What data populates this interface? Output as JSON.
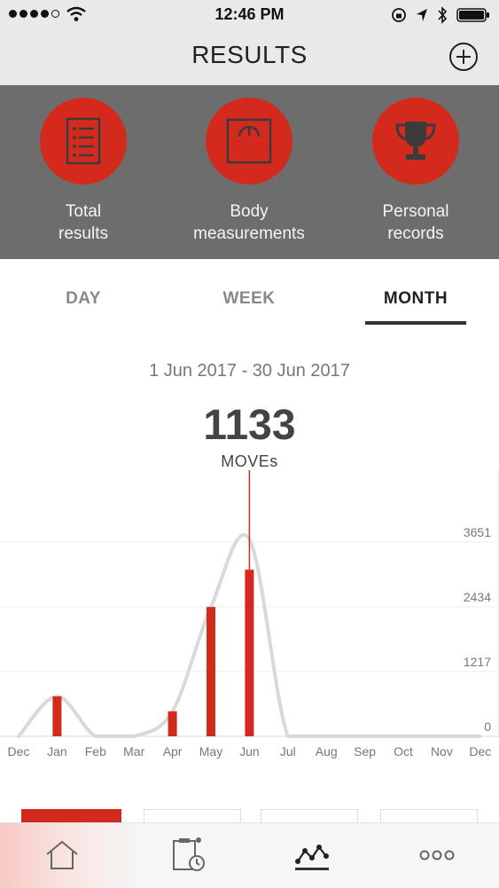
{
  "status_bar": {
    "time": "12:46 PM"
  },
  "header": {
    "title": "RESULTS",
    "add_icon": "plus-circle-icon"
  },
  "categories": [
    {
      "label": "Total\nresults",
      "icon": "list-icon"
    },
    {
      "label": "Body\nmeasurements",
      "icon": "scale-icon"
    },
    {
      "label": "Personal\nrecords",
      "icon": "trophy-icon"
    }
  ],
  "tabs": [
    {
      "label": "DAY",
      "active": false
    },
    {
      "label": "WEEK",
      "active": false
    },
    {
      "label": "MONTH",
      "active": true
    }
  ],
  "summary": {
    "range": "1 Jun 2017 - 30 Jun 2017",
    "value": "1133",
    "unit": "MOVEs"
  },
  "colors": {
    "accent": "#d42a1e",
    "band": "#6d6d6d",
    "header": "#e9e9e9"
  },
  "chart_data": {
    "type": "bar",
    "categories": [
      "Dec",
      "Jan",
      "Feb",
      "Mar",
      "Apr",
      "May",
      "Jun",
      "Jul",
      "Aug",
      "Sep",
      "Oct",
      "Nov",
      "Dec"
    ],
    "values": [
      0,
      750,
      0,
      0,
      470,
      2430,
      3130,
      0,
      0,
      0,
      0,
      0,
      0
    ],
    "trend": [
      0,
      750,
      0,
      0,
      470,
      2430,
      3700,
      0,
      0,
      0,
      0,
      0,
      0
    ],
    "yticks": [
      "3651",
      "2434",
      "1217",
      "0"
    ],
    "ytick_values": [
      3651,
      2434,
      1217,
      0
    ],
    "ylim": [
      0,
      4500
    ],
    "selected_category": "Jun",
    "grid": true
  },
  "bottom_nav": [
    {
      "icon": "home-icon"
    },
    {
      "icon": "workout-timer-icon"
    },
    {
      "icon": "results-graph-icon",
      "active": true
    },
    {
      "icon": "more-icon"
    }
  ]
}
